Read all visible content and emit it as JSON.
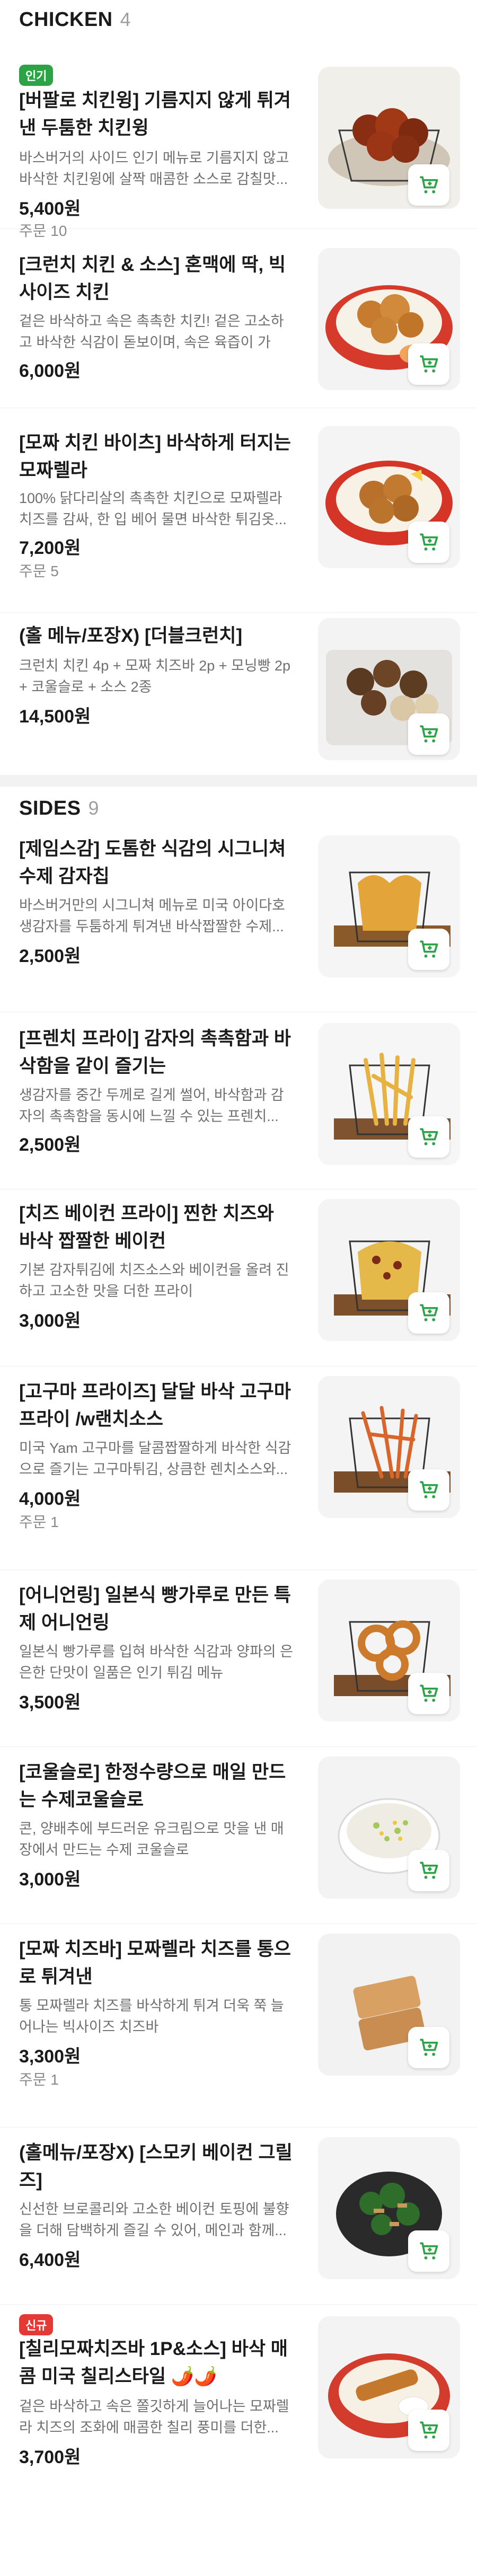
{
  "chicken": {
    "title": "CHICKEN",
    "count": "4",
    "items": [
      {
        "badge": "인기",
        "title": "[버팔로 치킨윙] 기름지지 않게 튀겨낸 두툼한 치킨윙",
        "desc": "바스버거의 사이드 인기 메뉴로 기름지지 않고 바삭한 치킨윙에 살짝 매콤한 소스로 감칠맛...",
        "price": "5,400원",
        "orders": "주문 10"
      },
      {
        "title": "[크런치 치킨 & 소스] 혼맥에 딱, 빅사이즈 치킨",
        "desc": "겉은 바삭하고 속은 촉촉한 치킨! 겉은 고소하고 바삭한 식감이 돋보이며, 속은 육즙이 가득...",
        "price": "6,000원"
      },
      {
        "title": "[모짜 치킨 바이츠] 바삭하게 터지는 모짜렐라",
        "desc": "100% 닭다리살의 촉촉한 치킨으로 모짜렐라 치즈를 감싸, 한 입 베어 물면 바삭한 튀김옷...",
        "price": "7,200원",
        "orders": "주문 5"
      },
      {
        "title": "(홀 메뉴/포장X) [더블크런치]",
        "desc": "크런치 치킨 4p + 모짜 치즈바 2p + 모닝빵 2p + 코울슬로 + 소스 2종",
        "price": "14,500원"
      }
    ]
  },
  "sides": {
    "title": "SIDES",
    "count": "9",
    "items": [
      {
        "title": "[제임스감] 도톰한 식감의 시그니쳐 수제 감자칩",
        "desc": "바스버거만의 시그니쳐 메뉴로 미국 아이다호 생감자를 두툼하게 튀겨낸 바삭짭짤한 수제...",
        "price": "2,500원"
      },
      {
        "title": "[프렌치 프라이] 감자의 촉촉함과 바삭함을 같이 즐기는",
        "desc": "생감자를 중간 두께로 길게 썰어, 바삭함과 감자의 촉촉함을 동시에 느낄 수 있는 프렌치...",
        "price": "2,500원"
      },
      {
        "title": "[치즈 베이컨 프라이] 찐한 치즈와 바삭 짭짤한 베이컨",
        "desc": "기본 감자튀김에 치즈소스와 베이컨을 올려 진하고 고소한 맛을 더한 프라이",
        "price": "3,000원"
      },
      {
        "title": "[고구마 프라이즈] 달달 바삭 고구마 프라이 /w랜치소스",
        "desc": "미국 Yam 고구마를 달콤짭짤하게 바삭한 식감으로 즐기는 고구마튀김, 상큼한 렌치소스와...",
        "price": "4,000원",
        "orders": "주문 1"
      },
      {
        "title": "[어니언링] 일본식 빵가루로 만든 특제 어니언링",
        "desc": "일본식 빵가루를 입혀 바삭한 식감과 양파의 은은한 단맛이 일품은 인기 튀김 메뉴",
        "price": "3,500원"
      },
      {
        "title": "[코울슬로] 한정수량으로 매일 만드는 수제코울슬로",
        "desc": "콘, 양배추에 부드러운 유크림으로 맛을 낸 매장에서 만드는 수제 코울슬로",
        "price": "3,000원"
      },
      {
        "title": "[모짜 치즈바] 모짜렐라 치즈를 통으로 튀겨낸",
        "desc": "통 모짜렐라 치즈를 바삭하게 튀겨 더욱 쭉 늘어나는 빅사이즈 치즈바",
        "price": "3,300원",
        "orders": "주문 1"
      },
      {
        "title": "(홀메뉴/포장X) [스모키 베이컨 그릴즈]",
        "desc": "신선한 브로콜리와 고소한 베이컨 토핑에 불향을 더해 담백하게 즐길 수 있어, 메인과 함께...",
        "price": "6,400원"
      },
      {
        "badge": "신규",
        "title": "[칠리모짜치즈바 1P&소스] 바삭 매콤 미국 칠리스타일 🌶️🌶️",
        "desc": "겉은 바삭하고 속은 쫄깃하게 늘어나는 모짜렐라 치즈의 조화에 매콤한 칠리 풍미를 더한...",
        "price": "3,700원"
      }
    ]
  },
  "icons": {
    "cart": "cart-icon"
  },
  "colors": {
    "accent": "#2ca347",
    "new_badge": "#e53935"
  }
}
